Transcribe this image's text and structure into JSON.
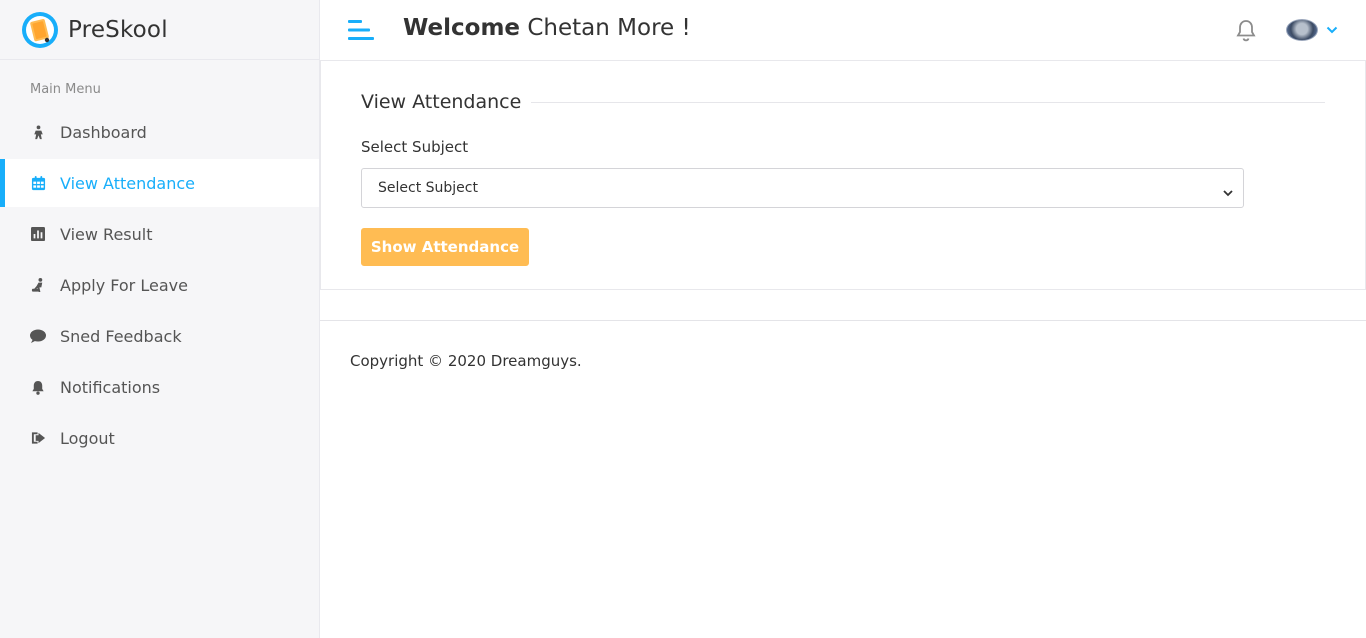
{
  "brand": {
    "name": "PreSkool"
  },
  "sidebar": {
    "section_title": "Main Menu",
    "items": [
      {
        "label": "Dashboard",
        "icon": "dashboard-icon",
        "active": false
      },
      {
        "label": "View Attendance",
        "icon": "calendar-icon",
        "active": true
      },
      {
        "label": "View Result",
        "icon": "bar-chart-icon",
        "active": false
      },
      {
        "label": "Apply For Leave",
        "icon": "leave-icon",
        "active": false
      },
      {
        "label": "Sned Feedback",
        "icon": "comment-icon",
        "active": false
      },
      {
        "label": "Notifications",
        "icon": "bell-icon",
        "active": false
      },
      {
        "label": "Logout",
        "icon": "logout-icon",
        "active": false
      }
    ]
  },
  "header": {
    "welcome_bold": "Welcome",
    "welcome_name": "Chetan More !"
  },
  "card": {
    "title": "View Attendance",
    "field_label": "Select Subject",
    "select_value": "Select Subject",
    "button_label": "Show Attendance"
  },
  "footer": {
    "copyright": "Copyright © 2020 Dreamguys."
  },
  "colors": {
    "accent": "#18aefa",
    "button": "#ffbc53",
    "sidebar_bg": "#f6f6f8"
  }
}
